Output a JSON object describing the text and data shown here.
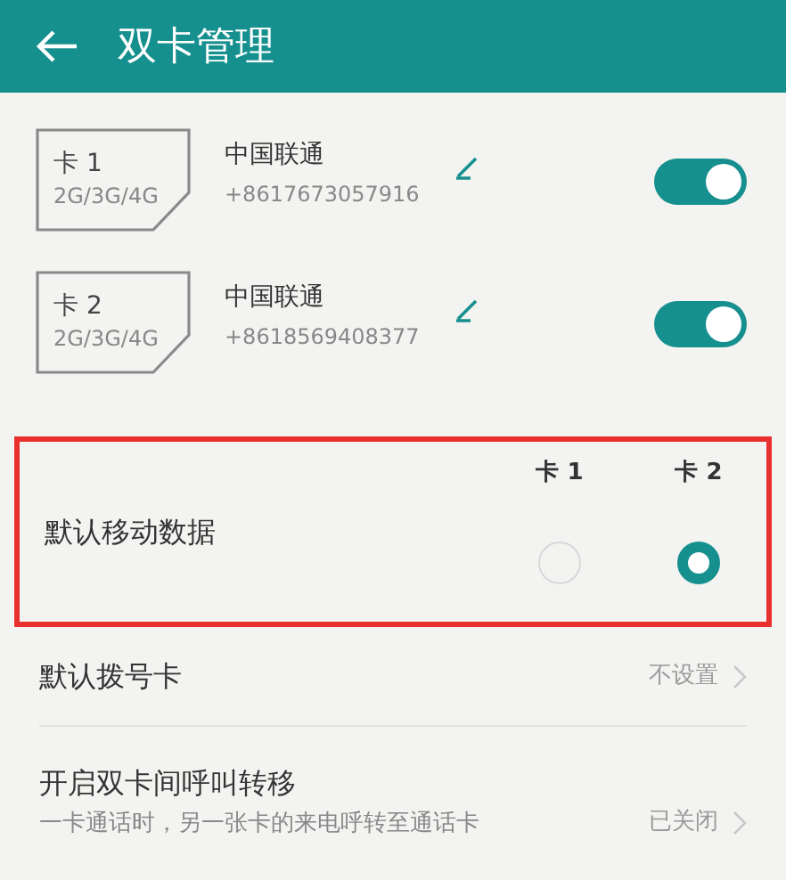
{
  "header": {
    "title": "双卡管理"
  },
  "sim_cards": [
    {
      "slot": "卡 1",
      "networks": "2G/3G/4G",
      "carrier": "中国联通",
      "number": "+8617673057916",
      "on": true
    },
    {
      "slot": "卡 2",
      "networks": "2G/3G/4G",
      "carrier": "中国联通",
      "number": "+8618569408377",
      "on": true
    }
  ],
  "default_data": {
    "label": "默认移动数据",
    "highlighted": true,
    "options": [
      {
        "label": "卡 1",
        "selected": false
      },
      {
        "label": "卡 2",
        "selected": true
      }
    ]
  },
  "settings": [
    {
      "title": "默认拨号卡",
      "value": "不设置"
    },
    {
      "title": "开启双卡间呼叫转移",
      "subtitle": "一卡通话时，另一张卡的来电呼转至通话卡",
      "value": "已关闭"
    }
  ]
}
